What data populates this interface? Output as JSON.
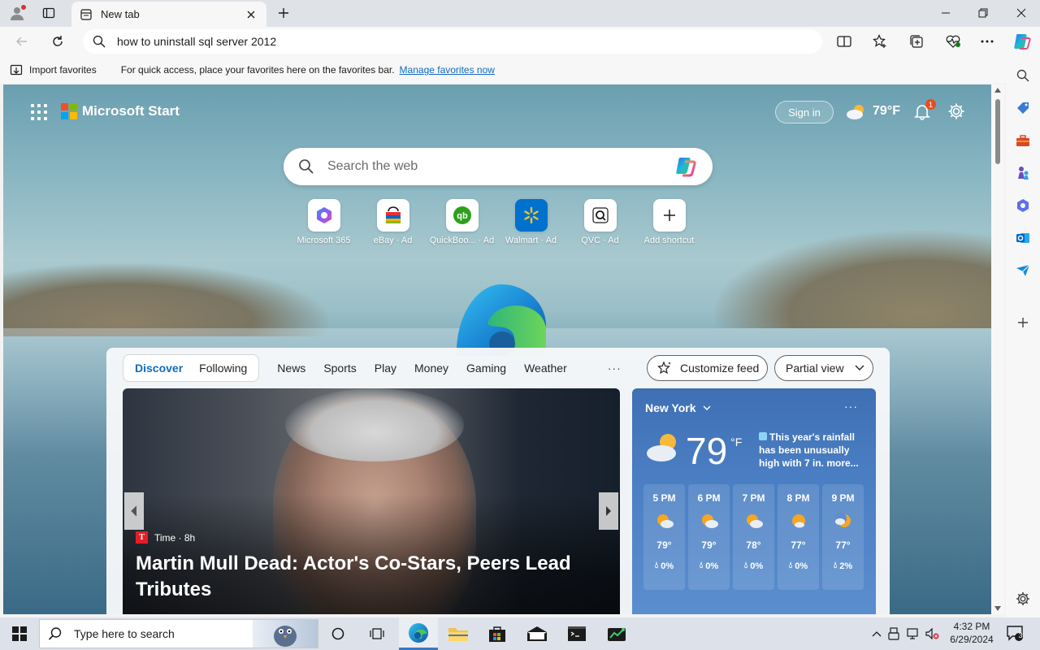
{
  "browser": {
    "tab": {
      "title": "New tab"
    },
    "address": {
      "url": "how to uninstall sql server 2012"
    },
    "favorites_bar": {
      "import_label": "Import favorites",
      "message": "For quick access, place your favorites here on the favorites bar.",
      "link": "Manage favorites now"
    }
  },
  "start": {
    "brand": "Microsoft Start",
    "sign_in": "Sign in",
    "weather_temp": "79°F",
    "notification_count": "1",
    "search_placeholder": "Search the web",
    "shortcuts": [
      {
        "label": "Microsoft 365",
        "icon": "microsoft-365-icon"
      },
      {
        "label": "eBay · Ad",
        "icon": "ebay-icon"
      },
      {
        "label": "QuickBoo... · Ad",
        "icon": "quickbooks-icon"
      },
      {
        "label": "Walmart · Ad",
        "icon": "walmart-icon"
      },
      {
        "label": "QVC · Ad",
        "icon": "qvc-icon"
      },
      {
        "label": "Add shortcut",
        "icon": "plus-icon"
      }
    ]
  },
  "feed": {
    "tabs": [
      "Discover",
      "Following"
    ],
    "nav": [
      "News",
      "Sports",
      "Play",
      "Money",
      "Gaming",
      "Weather"
    ],
    "more": "···",
    "customize": "Customize feed",
    "view": "Partial view",
    "hero": {
      "source": "Time · 8h",
      "source_logo": "T",
      "headline": "Martin Mull Dead: Actor's Co-Stars, Peers Lead Tributes"
    },
    "weather": {
      "location": "New York",
      "more": "···",
      "temp": "79",
      "unit": "°F",
      "note": "This year's rainfall has been unusually high with 7 in. more...",
      "hours": [
        {
          "time": "5 PM",
          "temp": "79°",
          "precip": "0%"
        },
        {
          "time": "6 PM",
          "temp": "79°",
          "precip": "0%"
        },
        {
          "time": "7 PM",
          "temp": "78°",
          "precip": "0%"
        },
        {
          "time": "8 PM",
          "temp": "77°",
          "precip": "0%"
        },
        {
          "time": "9 PM",
          "temp": "77°",
          "precip": "2%"
        }
      ]
    }
  },
  "taskbar": {
    "search_placeholder": "Type here to search",
    "time": "4:32 PM",
    "date": "6/29/2024",
    "notification_count": "3"
  },
  "colors": {
    "accent": "#0f6cbd",
    "weather_card": "#4b7fc3",
    "badge": "#e3501f"
  }
}
